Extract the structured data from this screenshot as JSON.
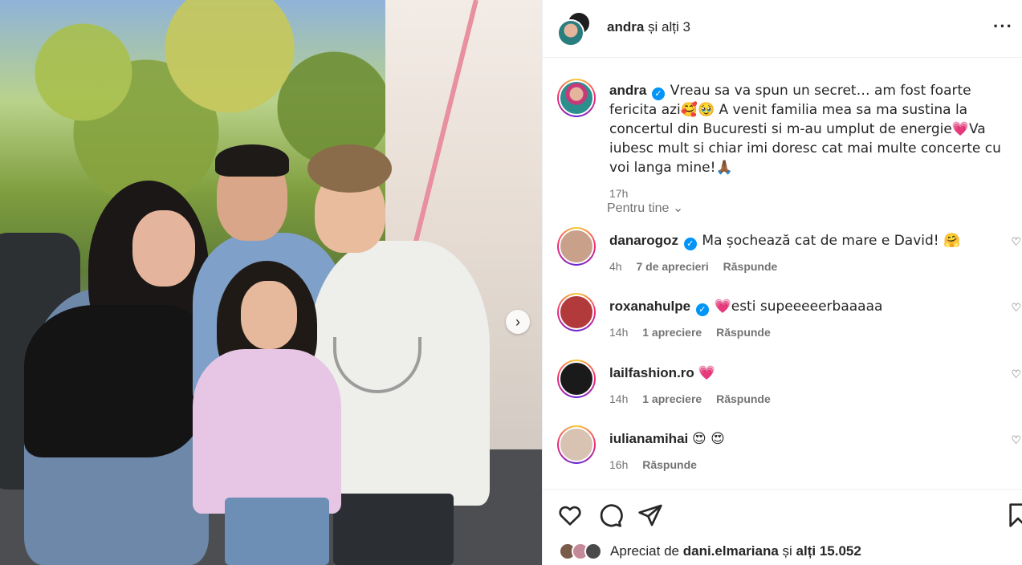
{
  "header": {
    "username": "andra",
    "others": " și alți 3"
  },
  "caption": {
    "username": "andra",
    "text": "Vreau sa va spun un secret… am fost foarte fericita azi🥰🥹 A venit familia mea sa ma sustina la concertul din Bucuresti si m-au umplut de energie💗Va iubesc mult si chiar imi doresc cat mai multe concerte cu voi langa mine!🙏🏾",
    "time": "17h"
  },
  "for_you_label": "Pentru tine",
  "comments": [
    {
      "username": "danarogoz",
      "verified": true,
      "text": "Ma șochează cat de mare e David! 🤗",
      "time": "4h",
      "likes": "7 de aprecieri",
      "reply": "Răspunde",
      "avatar_color": "#c9a18a"
    },
    {
      "username": "roxanahulpe",
      "verified": true,
      "text": "💗esti supeeeeerbaaaaa",
      "time": "14h",
      "likes": "1 apreciere",
      "reply": "Răspunde",
      "avatar_color": "#b23a3a"
    },
    {
      "username": "lailfashion.ro",
      "verified": false,
      "text": "💗",
      "time": "14h",
      "likes": "1 apreciere",
      "reply": "Răspunde",
      "avatar_color": "#1a1a1a"
    },
    {
      "username": "iulianamihai",
      "verified": false,
      "text": "😍 😍",
      "time": "16h",
      "likes": "",
      "reply": "Răspunde",
      "avatar_color": "#d8c3b3"
    }
  ],
  "likes": {
    "prefix": "Apreciat de ",
    "user": "dani.elmariana",
    "suffix": " și ",
    "others": "alți 15.052"
  },
  "icons": {
    "like": "heart-icon",
    "comment": "comment-icon",
    "share": "share-icon",
    "save": "bookmark-icon",
    "next": "chevron-right-icon",
    "more": "more-icon"
  }
}
